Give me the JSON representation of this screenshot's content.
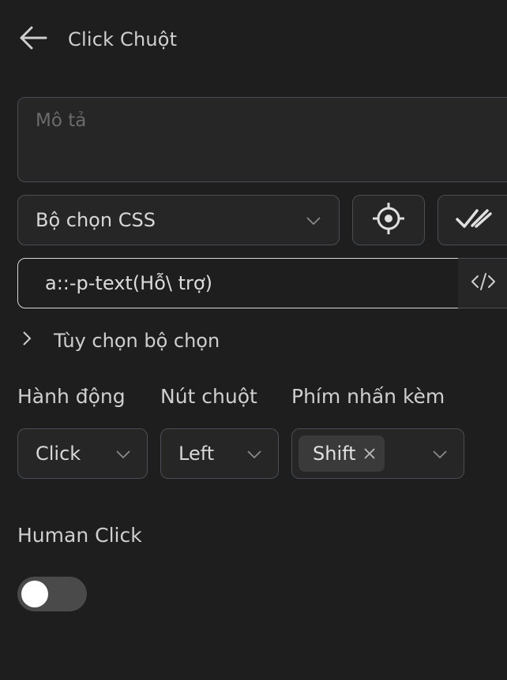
{
  "header": {
    "title": "Click Chuột"
  },
  "description": {
    "placeholder": "Mô tả"
  },
  "selector": {
    "type_label": "Bộ chọn CSS",
    "value": "a::-p-text(Hỗ\\ trợ)",
    "options_label": "Tùy chọn bộ chọn"
  },
  "fields": {
    "action_label": "Hành động",
    "action_value": "Click",
    "button_label": "Nút chuột",
    "button_value": "Left",
    "modifier_label": "Phím nhấn kèm",
    "modifier_chip": "Shift"
  },
  "human_click": {
    "label": "Human Click",
    "enabled": false
  },
  "colors": {
    "background": "#1e1e1e",
    "border": "#4a4e52",
    "text": "#d6d6d6",
    "toggle_off": "#4a4a4a"
  }
}
